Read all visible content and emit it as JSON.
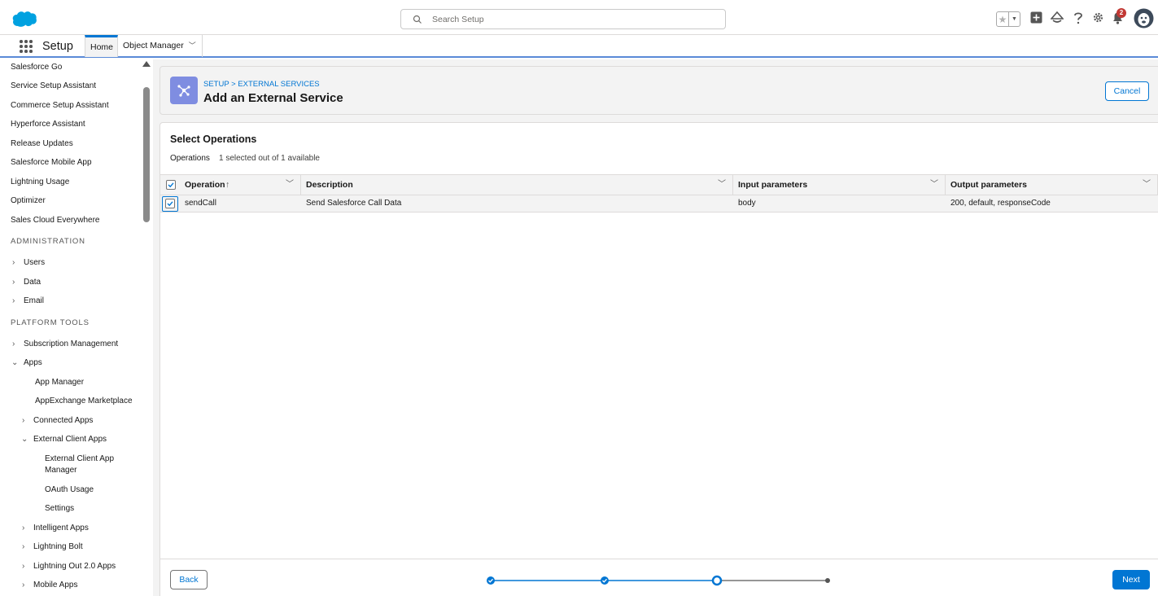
{
  "header": {
    "search_placeholder": "Search Setup",
    "notification_count": "2",
    "icons": [
      "salesforce-logo",
      "search-icon",
      "star-icon",
      "chevron-down-icon",
      "add-icon",
      "trailhead-icon",
      "help-icon",
      "gear-icon",
      "bell-icon",
      "avatar"
    ]
  },
  "context_bar": {
    "app_name": "Setup",
    "tabs": [
      {
        "label": "Home"
      },
      {
        "label": "Object Manager"
      }
    ]
  },
  "sidebar": {
    "items_top": [
      "Salesforce Go",
      "Service Setup Assistant",
      "Commerce Setup Assistant",
      "Hyperforce Assistant",
      "Release Updates",
      "Salesforce Mobile App",
      "Lightning Usage",
      "Optimizer",
      "Sales Cloud Everywhere"
    ],
    "section_admin": "ADMINISTRATION",
    "admin_items": [
      "Users",
      "Data",
      "Email"
    ],
    "section_platform": "PLATFORM TOOLS",
    "platform_items": {
      "subscription": "Subscription Management",
      "apps": "Apps",
      "app_manager": "App Manager",
      "appexchange": "AppExchange Marketplace",
      "connected_apps": "Connected Apps",
      "external_client_apps": "External Client Apps",
      "ext_client_app_manager_1": "External Client App",
      "ext_client_app_manager_2": "Manager",
      "oauth_usage": "OAuth Usage",
      "settings": "Settings",
      "intelligent_apps": "Intelligent Apps",
      "lightning_bolt": "Lightning Bolt",
      "lightning_out": "Lightning Out 2.0 Apps",
      "mobile_apps": "Mobile Apps"
    }
  },
  "page_header": {
    "breadcrumb": "SETUP > EXTERNAL SERVICES",
    "title": "Add an External Service",
    "cancel_label": "Cancel"
  },
  "operations": {
    "title": "Select Operations",
    "label": "Operations",
    "count_text": "1 selected out of 1 available",
    "columns": [
      "Operation",
      "Description",
      "Input parameters",
      "Output parameters"
    ],
    "rows": [
      {
        "selected": true,
        "operation": "sendCall",
        "description": "Send Salesforce Call Data",
        "input": "body",
        "output": "200, default, responseCode"
      }
    ]
  },
  "footer": {
    "back_label": "Back",
    "next_label": "Next",
    "progress_steps": 4,
    "progress_current_step": 3
  },
  "colors": {
    "brand_blue": "#0176d3",
    "icon_purple": "#7f8de1",
    "badge_red": "#c23934",
    "cloud_blue": "#00a1e0"
  }
}
